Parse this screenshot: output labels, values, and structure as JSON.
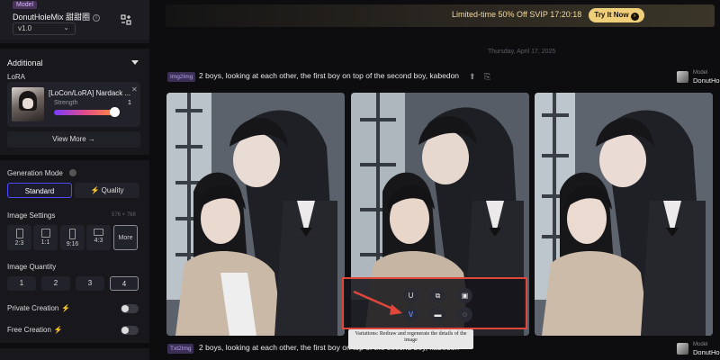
{
  "sidebar": {
    "model": {
      "badge": "Model",
      "name": "DonutHoleMix 甜甜圈",
      "info_icon": "info-icon",
      "version": "v1.0",
      "swap_icon": "swap-icon"
    },
    "additional": {
      "title": "Additional",
      "lora_label": "LoRA",
      "lora": {
        "name": "[LoCon/LoRA] Nardack ...",
        "strength_label": "Strength",
        "strength_value": "1",
        "strength_fraction": 1.0
      },
      "view_more": "View More →"
    },
    "generation_mode": {
      "label": "Generation Mode",
      "options": [
        "Standard",
        "Quality"
      ],
      "quality_prefix": "⚡",
      "selected": "Standard"
    },
    "image_settings": {
      "label": "Image Settings",
      "size": "576 × 768",
      "ratios": [
        "2:3",
        "1:1",
        "9:16",
        "4:3",
        "More"
      ],
      "selected": "More"
    },
    "image_quantity": {
      "label": "Image Quantity",
      "options": [
        "1",
        "2",
        "3",
        "4"
      ],
      "selected": "4"
    },
    "private_creation": {
      "label": "Private Creation",
      "vip": "⚡",
      "on": false
    },
    "free_creation": {
      "label": "Free Creation",
      "vip": "⚡",
      "on": false
    }
  },
  "main": {
    "promo": {
      "text": "Limited-time 50% Off SVIP 17:20:18",
      "button": "Try It Now",
      "button_icon": "›"
    },
    "date": "Thursday, April 17, 2025",
    "task1": {
      "badge": "Img2Img",
      "prompt": "2 boys, looking at each other, the first boy on top of the second boy, kabedon",
      "model_label": "Model",
      "model_name": "DonutHole..."
    },
    "task2": {
      "badge": "Txt2Img",
      "prompt": "2 boys, looking at each other, the first boy on top of the second boy, kabedon",
      "model_label": "Model",
      "model_name": "DonutHole..."
    },
    "hover_actions": {
      "upscale": "U",
      "variation": "V",
      "tooltip": "Variations: Redraw and regenerate the details of the image"
    }
  }
}
